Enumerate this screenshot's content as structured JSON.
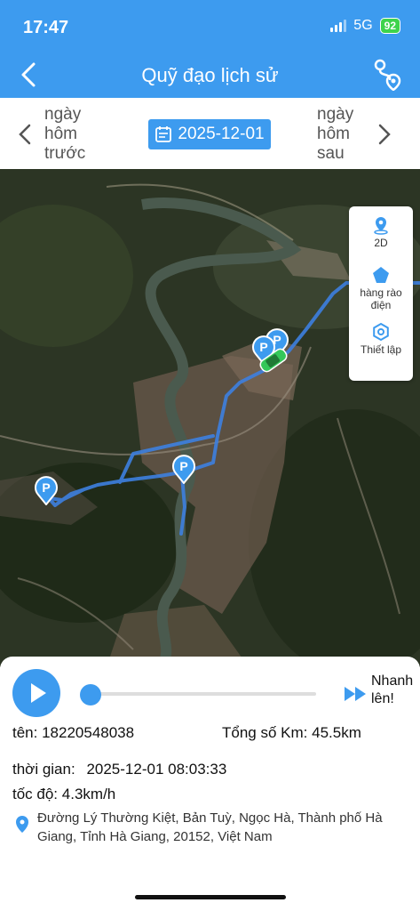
{
  "status_bar": {
    "time": "17:47",
    "network": "5G",
    "battery": "92"
  },
  "header": {
    "title": "Quỹ đạo lịch sử"
  },
  "date_bar": {
    "prev_label": "ngày hôm trước",
    "date": "2025-12-01",
    "next_label": "ngày hôm sau"
  },
  "map_panel": {
    "mode_label": "2D",
    "fence_label": "hàng rào điện",
    "settings_label": "Thiết lập"
  },
  "markers": [
    "P",
    "P",
    "P",
    "P"
  ],
  "playback": {
    "progress": 0.0,
    "speed_label": "Nhanh lên!"
  },
  "info": {
    "name_label": "tên:",
    "name_value": "18220548038",
    "total_km_label": "Tổng số Km:",
    "total_km_value": "45.5km",
    "time_label": "thời gian:",
    "time_value": "2025-12-01 08:03:33",
    "speed_label": "tốc độ:",
    "speed_value": "4.3km/h",
    "address": "Đường Lý Thường Kiệt, Bản Tuỳ, Ngọc Hà, Thành phố Hà Giang, Tỉnh Hà Giang, 20152, Việt Nam"
  },
  "colors": {
    "accent": "#3d9bef",
    "battery": "#3ed34c",
    "car": "#34c759"
  }
}
